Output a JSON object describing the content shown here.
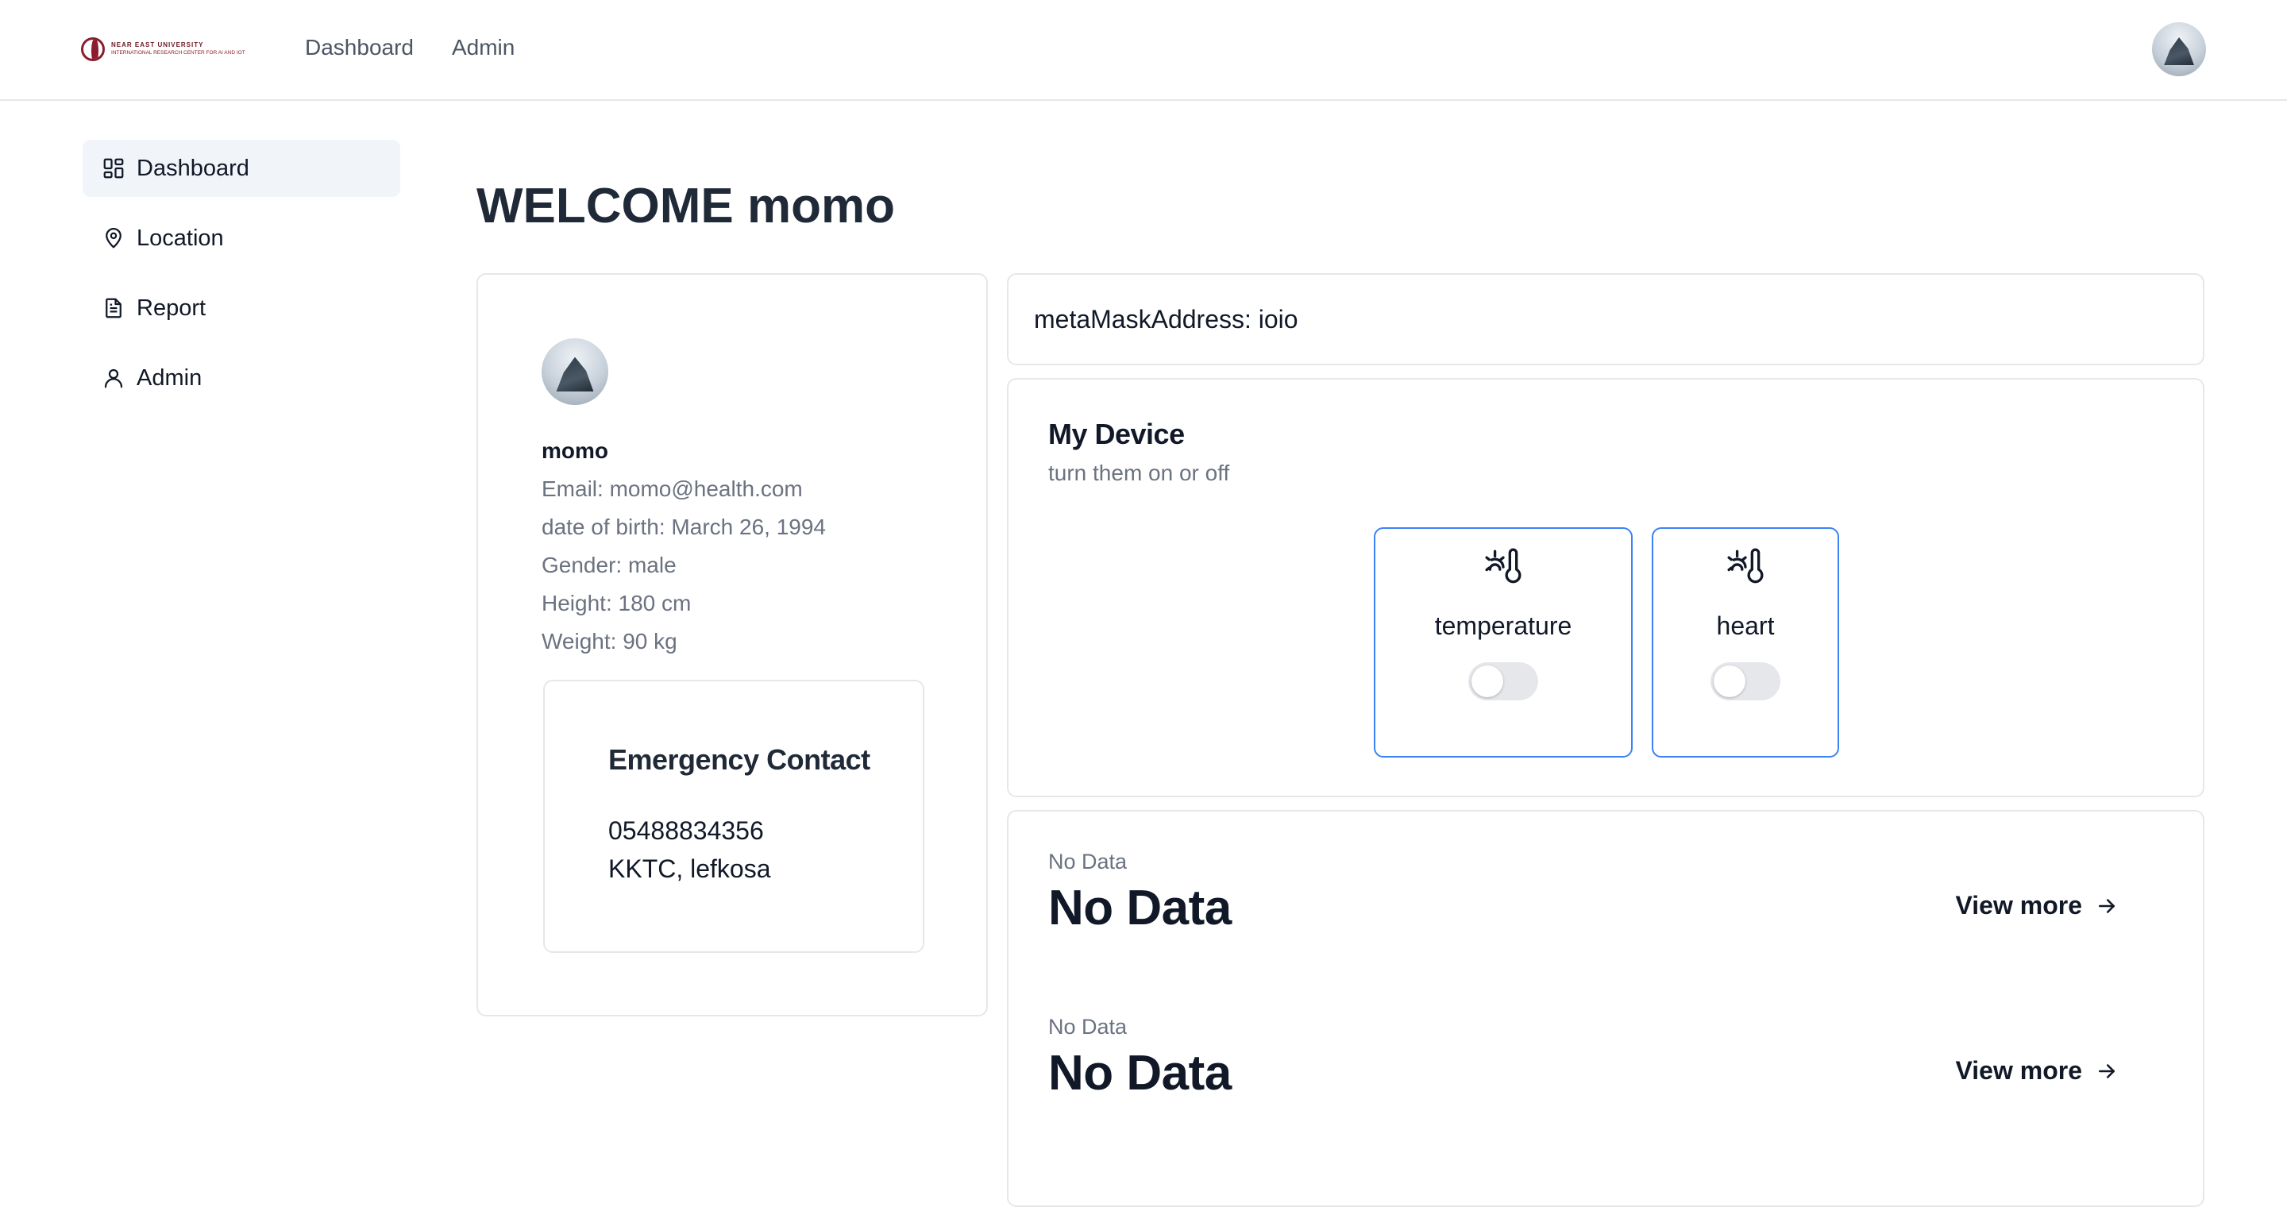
{
  "header": {
    "logo": {
      "line1": "NEAR EAST UNIVERSITY",
      "line2": "INTERNATIONAL RESEARCH CENTER FOR AI AND IOT"
    },
    "nav": [
      "Dashboard",
      "Admin"
    ]
  },
  "sidebar": {
    "items": [
      {
        "label": "Dashboard",
        "icon": "dashboard-icon",
        "active": true
      },
      {
        "label": "Location",
        "icon": "location-pin-icon",
        "active": false
      },
      {
        "label": "Report",
        "icon": "document-icon",
        "active": false
      },
      {
        "label": "Admin",
        "icon": "user-icon",
        "active": false
      }
    ]
  },
  "main": {
    "welcome": "WELCOME momo",
    "profile": {
      "name": "momo",
      "email": "Email: momo@health.com",
      "dob": "date of birth: March 26, 1994",
      "gender": "Gender: male",
      "height": "Height: 180 cm",
      "weight": "Weight: 90 kg",
      "emergency": {
        "title": "Emergency Contact",
        "phone": "05488834356",
        "address": "KKTC, lefkosa"
      }
    },
    "meta": "metaMaskAddress: ioio",
    "device": {
      "title": "My Device",
      "subtitle": "turn them on or off",
      "items": [
        {
          "label": "temperature",
          "icon": "thermometer-sun-icon",
          "on": false
        },
        {
          "label": "heart",
          "icon": "thermometer-sun-icon",
          "on": false
        }
      ]
    },
    "data_rows": [
      {
        "small": "No Data",
        "big": "No Data",
        "link": "View more"
      },
      {
        "small": "No Data",
        "big": "No Data",
        "link": "View more"
      }
    ]
  },
  "colors": {
    "accent_border": "#3b82f6",
    "active_bg": "#f1f5f9",
    "muted_text": "#6b7280",
    "logo": "#8b1d2c"
  }
}
